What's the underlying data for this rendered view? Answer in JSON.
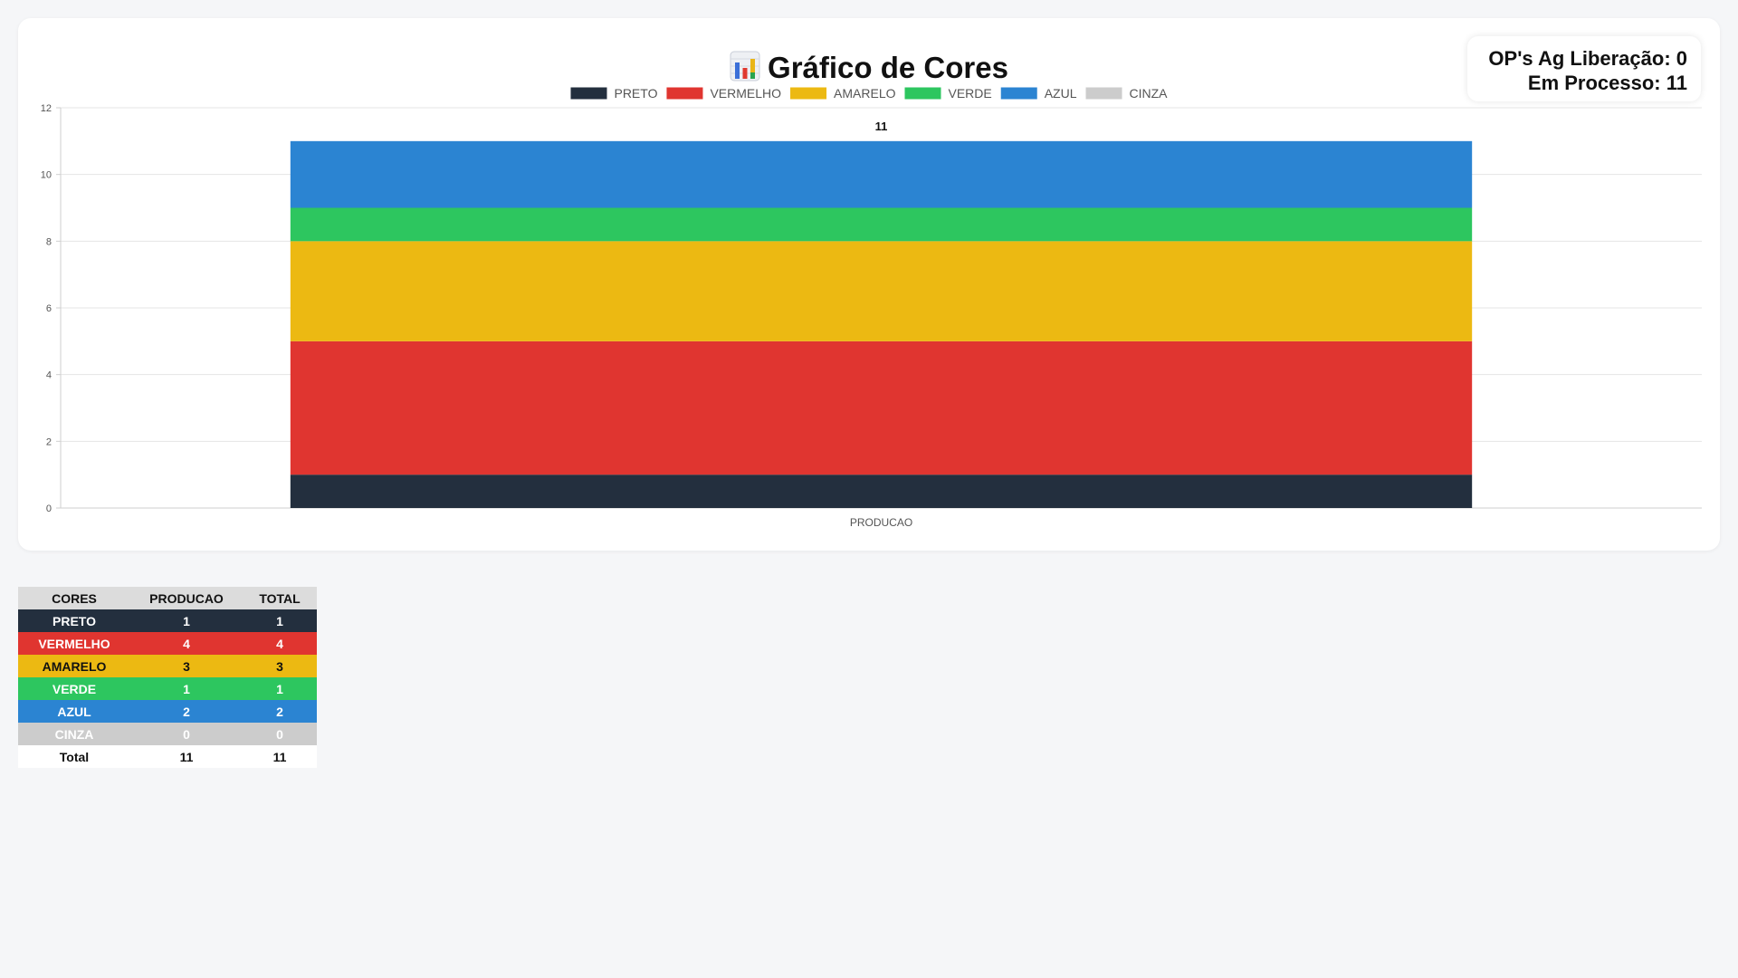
{
  "title": "Gráfico de Cores",
  "title_icon": "bar-chart-emoji-icon",
  "status": {
    "ag_liberacao": "OP's Ag Liberação: 0",
    "em_processo": "Em Processo: 11"
  },
  "chart_data": {
    "type": "bar",
    "stacked": true,
    "categories": [
      "PRODUCAO"
    ],
    "series": [
      {
        "name": "PRETO",
        "values": [
          1
        ],
        "color": "#232f3e"
      },
      {
        "name": "VERMELHO",
        "values": [
          4
        ],
        "color": "#e03530"
      },
      {
        "name": "AMARELO",
        "values": [
          3
        ],
        "color": "#ecb912"
      },
      {
        "name": "VERDE",
        "values": [
          1
        ],
        "color": "#2dc65f"
      },
      {
        "name": "AZUL",
        "values": [
          2
        ],
        "color": "#2b84d2"
      },
      {
        "name": "CINZA",
        "values": [
          0
        ],
        "color": "#cccccc"
      }
    ],
    "total_labels": [
      "11"
    ],
    "ylim": [
      0,
      12
    ],
    "yticks": [
      0,
      2,
      4,
      6,
      8,
      10,
      12
    ],
    "grid": true,
    "legend": "top-center",
    "title": "",
    "xlabel": "",
    "ylabel": ""
  },
  "table": {
    "headers": [
      "CORES",
      "PRODUCAO",
      "TOTAL"
    ],
    "rows": [
      {
        "cor": "PRETO",
        "producao": "1",
        "total": "1",
        "bg": "#232f3e",
        "fg": "#ffffff"
      },
      {
        "cor": "VERMELHO",
        "producao": "4",
        "total": "4",
        "bg": "#e03530",
        "fg": "#ffffff"
      },
      {
        "cor": "AMARELO",
        "producao": "3",
        "total": "3",
        "bg": "#ecb912",
        "fg": "#111111"
      },
      {
        "cor": "VERDE",
        "producao": "1",
        "total": "1",
        "bg": "#2dc65f",
        "fg": "#ffffff"
      },
      {
        "cor": "AZUL",
        "producao": "2",
        "total": "2",
        "bg": "#2b84d2",
        "fg": "#ffffff"
      },
      {
        "cor": "CINZA",
        "producao": "0",
        "total": "0",
        "bg": "#cccccc",
        "fg": "#ffffff"
      }
    ],
    "total_row": {
      "cor": "Total",
      "producao": "11",
      "total": "11"
    }
  }
}
